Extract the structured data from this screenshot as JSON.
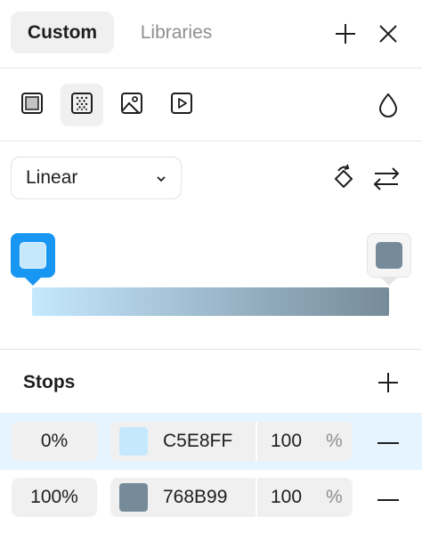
{
  "header": {
    "tabs": [
      {
        "label": "Custom",
        "active": true
      },
      {
        "label": "Libraries",
        "active": false
      }
    ],
    "add_icon": "plus-icon",
    "close_icon": "close-icon"
  },
  "fill_types": [
    {
      "name": "solid",
      "icon": "solid-fill-icon",
      "selected": false
    },
    {
      "name": "gradient",
      "icon": "gradient-fill-icon",
      "selected": true
    },
    {
      "name": "image",
      "icon": "image-fill-icon",
      "selected": false
    },
    {
      "name": "video",
      "icon": "video-fill-icon",
      "selected": false
    }
  ],
  "blend_icon": "blend-mode-icon",
  "gradient": {
    "type": "Linear",
    "rotate_icon": "rotate-icon",
    "flip_icon": "swap-direction-icon",
    "start_color": "#C5E8FF",
    "end_color": "#768B99"
  },
  "stops": {
    "title": "Stops",
    "items": [
      {
        "position": "0%",
        "color": "#C5E8FF",
        "hex": "C5E8FF",
        "opacity": "100",
        "unit": "%",
        "selected": true
      },
      {
        "position": "100%",
        "color": "#768B99",
        "hex": "768B99",
        "opacity": "100",
        "unit": "%",
        "selected": false
      }
    ]
  }
}
